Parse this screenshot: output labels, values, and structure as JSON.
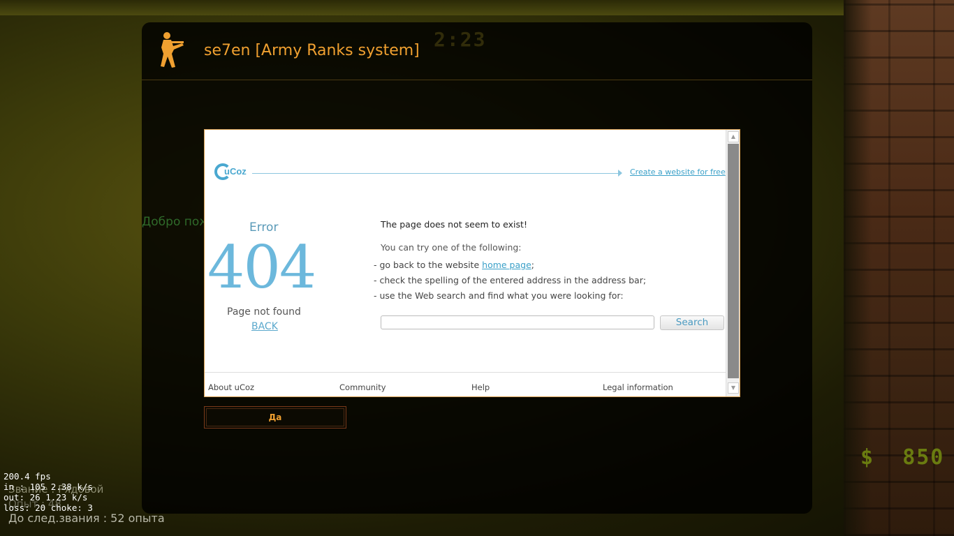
{
  "motd": {
    "title": "se7en [Army Ranks system]",
    "timer": "2:23",
    "welcome": "Добро пож"
  },
  "frame": {
    "logo_text": "uCoz",
    "create_link": "Create a website for free",
    "error_label": "Error",
    "error_code": "404",
    "page_not_found": "Page not found",
    "back": "BACK",
    "msg_main": "The page does not seem to exist!",
    "msg_try": "You can try one of the following:",
    "options": [
      {
        "prefix": "- go back to the website ",
        "link": "home page",
        "suffix": ";"
      },
      {
        "text": "- check the spelling of the entered address in the address bar;"
      },
      {
        "text": "- use the Web search and find what you were looking for:"
      }
    ],
    "search_placeholder": "",
    "search_button": "Search",
    "footer": [
      "About uCoz",
      "Community",
      "Help",
      "Legal information"
    ]
  },
  "ok_button": "Да",
  "hud": {
    "money_symbol": "$",
    "money": "850",
    "rank_line": "Звание : Рядовой",
    "exp_line": "Опыт : 48",
    "next_line": "До след.звания : 52 опыта"
  },
  "netgraph": {
    "fps": "200.4 fps",
    "in": "in : 105 2.38 k/s",
    "out": "out: 26 1.23 k/s",
    "loss": "loss: 20 choke: 3"
  },
  "colors": {
    "accent": "#f0a030",
    "link": "#3aa0c8",
    "error_code": "#6cb8dc"
  }
}
